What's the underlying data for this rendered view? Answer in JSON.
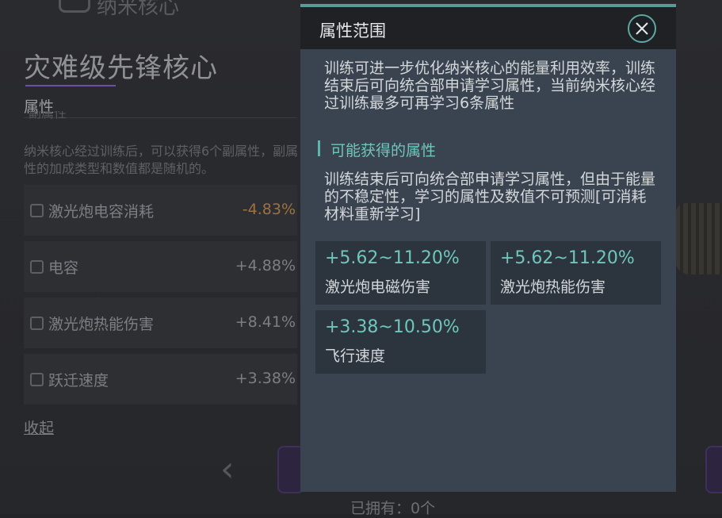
{
  "background": {
    "page_title": "灾难级先锋核心",
    "section_label": "属性",
    "sub_label": "副属性",
    "description": "纳米核心经过训练后，可以获得6个副属性，副属性的加成类型和数值都是随机的。",
    "attributes": [
      {
        "label": "激光炮电容消耗",
        "value": "-4.83%"
      },
      {
        "label": "电容",
        "value": "+4.88%"
      },
      {
        "label": "激光炮热能伤害",
        "value": "+8.41%"
      },
      {
        "label": "跃迁速度",
        "value": "+3.38%"
      }
    ],
    "collapse_label": "收起",
    "owned_label": "已拥有：0个",
    "nav_prev_glyph": "‹"
  },
  "modal": {
    "title": "属性范围",
    "intro": "训练可进一步优化纳米核心的能量利用效率，训练结束后可向统合部申请学习属性，当前纳米核心经过训练最多可再学习6条属性",
    "section_title": "可能获得的属性",
    "section_desc": "训练结束后可向统合部申请学习属性，但由于能量的不稳定性，学习的属性及数值不可预测[可消耗材料重新学习]",
    "possible_attributes": [
      {
        "range": "+5.62~11.20%",
        "name": "激光炮电磁伤害"
      },
      {
        "range": "+5.62~11.20%",
        "name": "激光炮热能伤害"
      },
      {
        "range": "+3.38~10.50%",
        "name": "飞行速度"
      }
    ]
  },
  "colors": {
    "accent_teal": "#6fc6bc",
    "modal_bg": "#3a4451",
    "negative_value": "#9b7240",
    "title_underline": "#6c4fa8"
  },
  "icons": [
    "close-icon",
    "chip-icon",
    "nanocore-icon",
    "chevron-left-icon"
  ]
}
